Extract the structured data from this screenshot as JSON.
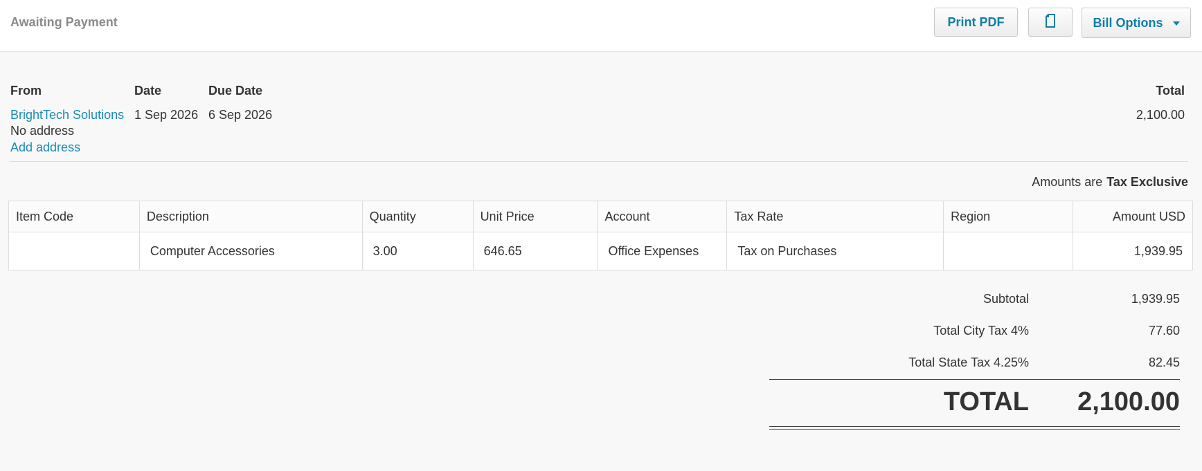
{
  "header": {
    "status": "Awaiting Payment",
    "print_pdf_label": "Print PDF",
    "copy_icon": "document-copy-icon",
    "bill_options_label": "Bill Options"
  },
  "bill": {
    "from_label": "From",
    "date_label": "Date",
    "due_date_label": "Due Date",
    "total_label": "Total",
    "from_name": "BrightTech Solutions",
    "no_address": "No address",
    "add_address": "Add address",
    "date": "1 Sep 2026",
    "due_date": "6 Sep 2026",
    "total": "2,100.00"
  },
  "amounts": {
    "prefix": "Amounts are",
    "mode": "Tax Exclusive"
  },
  "table": {
    "columns": [
      "Item Code",
      "Description",
      "Quantity",
      "Unit Price",
      "Account",
      "Tax Rate",
      "Region",
      "Amount USD"
    ],
    "rows": [
      [
        "",
        "Computer Accessories",
        "3.00",
        "646.65",
        "Office Expenses",
        "Tax on Purchases",
        "",
        "1,939.95"
      ]
    ]
  },
  "totals": {
    "subtotal_label": "Subtotal",
    "subtotal": "1,939.95",
    "city_tax_label": "Total City Tax 4%",
    "city_tax": "77.60",
    "state_tax_label": "Total State Tax 4.25%",
    "state_tax": "82.45",
    "total_label": "TOTAL",
    "total": "2,100.00"
  },
  "colors": {
    "link": "#1a8bb5",
    "button_text": "#0f7ea8",
    "status_text": "#8a8a8a"
  }
}
